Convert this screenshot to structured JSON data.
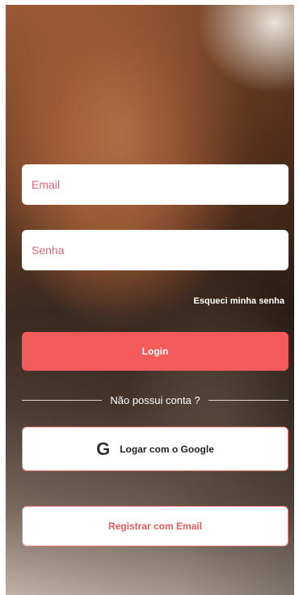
{
  "email_field": {
    "placeholder": "Email"
  },
  "password_field": {
    "placeholder": "Senha"
  },
  "forgot_password": "Esqueci minha senha",
  "login_button": "Login",
  "divider_text": "Não possui conta ?",
  "google_button": {
    "label": "Logar com o Google",
    "icon": "G"
  },
  "register_button": "Registrar com Email",
  "colors": {
    "accent": "#f55a5a",
    "placeholder": "#e0677a"
  }
}
